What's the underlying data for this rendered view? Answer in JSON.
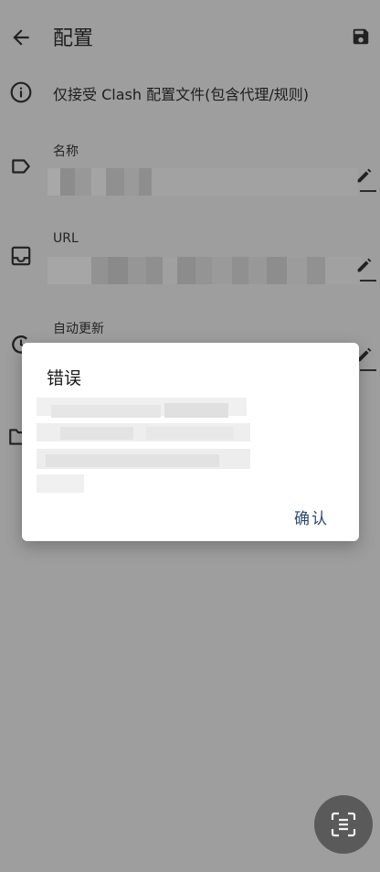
{
  "appbar": {
    "title": "配置"
  },
  "notice": {
    "text": "仅接受 Clash 配置文件(包含代理/规则)"
  },
  "fields": {
    "name": {
      "label": "名称"
    },
    "url": {
      "label": "URL"
    },
    "auto_update": {
      "label": "自动更新"
    }
  },
  "dialog": {
    "title": "错误",
    "confirm_label": "确认"
  },
  "icons": {
    "back": "arrow-back-icon",
    "save": "save-icon",
    "info": "info-icon",
    "name": "label-tag-icon",
    "url": "inbox-icon",
    "auto_update": "update-clock-icon",
    "file": "folder-icon",
    "edit": "pencil-icon",
    "fab": "scan-text-icon"
  },
  "colors": {
    "scrim_background": "#9e9e9e",
    "dialog_background": "#ffffff",
    "confirm_text": "#2d4a6b",
    "fab_background": "#5a5a5a"
  }
}
